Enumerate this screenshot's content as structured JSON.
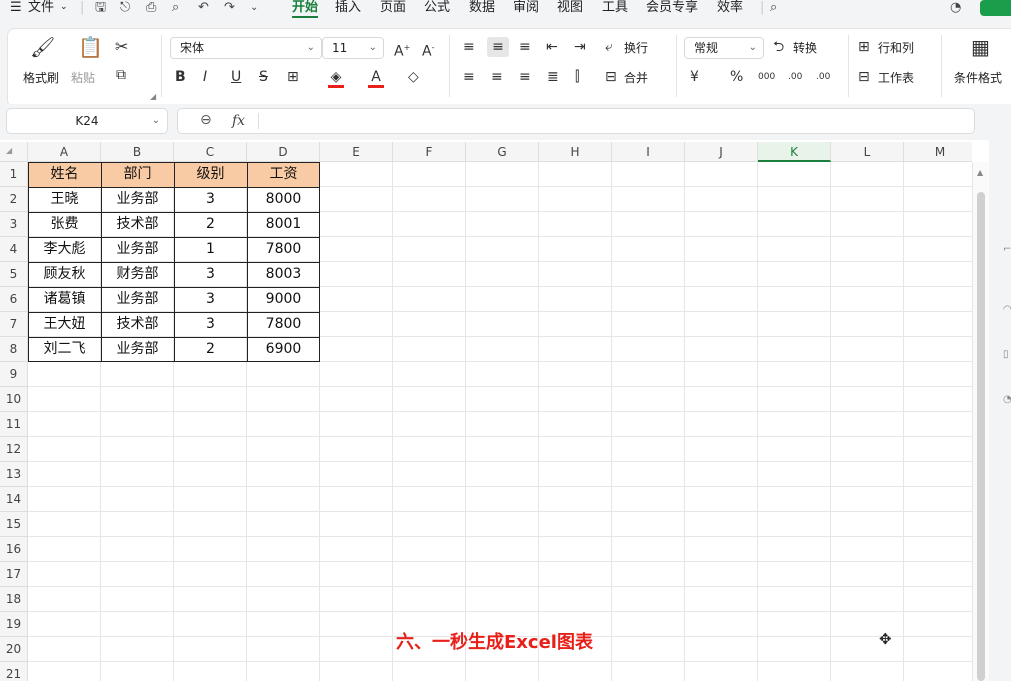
{
  "menu": {
    "file_label": "文件",
    "tabs": [
      "开始",
      "插入",
      "页面",
      "公式",
      "数据",
      "审阅",
      "视图",
      "工具",
      "会员专享",
      "效率"
    ],
    "active_tab": "开始"
  },
  "ribbon": {
    "format_painter": "格式刷",
    "paste": "粘贴",
    "font_name": "宋体",
    "font_size": "11",
    "wrap": "换行",
    "merge": "合并",
    "number_format": "常规",
    "convert": "转换",
    "rows_cols": "行和列",
    "worksheet": "工作表",
    "conditional_format": "条件格式",
    "bold": "B",
    "italic": "I",
    "underline": "U",
    "strike": "S",
    "currency": "¥",
    "percent": "%",
    "thousands": "000",
    "inc_dec": ".00",
    "font_grow": "A",
    "font_shrink": "A"
  },
  "formula_bar": {
    "name_box": "K24",
    "fx": "fx",
    "value": ""
  },
  "columns": [
    "A",
    "B",
    "C",
    "D",
    "E",
    "F",
    "G",
    "H",
    "I",
    "J",
    "K",
    "L",
    "M"
  ],
  "selected_column": "K",
  "rows": [
    "1",
    "2",
    "3",
    "4",
    "5",
    "6",
    "7",
    "8",
    "9",
    "10",
    "11",
    "12",
    "13",
    "14",
    "15",
    "16",
    "17",
    "18",
    "19",
    "20",
    "21"
  ],
  "table": {
    "headers": [
      "姓名",
      "部门",
      "级别",
      "工资"
    ],
    "rows": [
      [
        "王晓",
        "业务部",
        "3",
        "8000"
      ],
      [
        "张费",
        "技术部",
        "2",
        "8001"
      ],
      [
        "李大彪",
        "业务部",
        "1",
        "7800"
      ],
      [
        "顾友秋",
        "财务部",
        "3",
        "8003"
      ],
      [
        "诸葛镇",
        "业务部",
        "3",
        "9000"
      ],
      [
        "王大妞",
        "技术部",
        "3",
        "7800"
      ],
      [
        "刘二飞",
        "业务部",
        "2",
        "6900"
      ]
    ],
    "header_color": "#f8cba4"
  },
  "caption": "六、一秒生成Excel图表",
  "colors": {
    "accent": "#1a7f3c",
    "caption": "#e8201a"
  }
}
